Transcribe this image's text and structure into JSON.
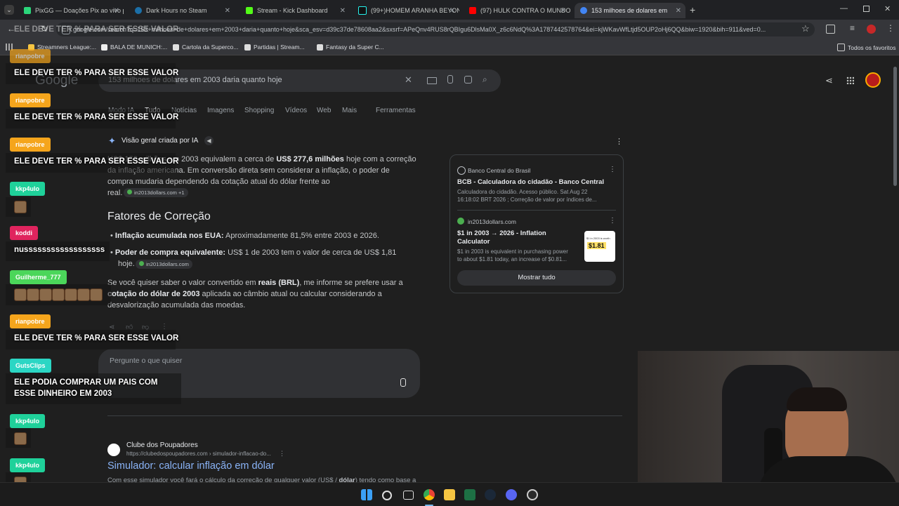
{
  "tabs": [
    {
      "label": "PixGG — Doações Pix ao vivo p",
      "color": "#2bd67b"
    },
    {
      "label": "Dark Hours no Steam",
      "color": "#1b6fa8"
    },
    {
      "label": "Stream - Kick Dashboard",
      "color": "#53fc18"
    },
    {
      "label": "(99+)HOMEM ARANHA BEYON",
      "color": "#111111"
    },
    {
      "label": "(97) HULK CONTRA O MUNDO",
      "color": "#ff0000"
    },
    {
      "label": "153 milhoes de dolares em 200",
      "color": "#4285f4"
    }
  ],
  "new_tab": "+",
  "url": "google.com/search?q=153+milhoes+de+dolares+em+2003+daria+quanto+hoje&sca_esv=d39c37de78608aa2&sxsrf=APeQnv4RUS8rQBIgu6DlsMa0X_z6c6NdQ%3A1787442578764&ei=kjWKavWfLtjd5OUP2oHj6QQ&biw=1920&bih=911&ved=0...",
  "url_overlay": "ELE DEVE TER % PARA SER ESSE VALOR",
  "bookmarks": [
    {
      "label": "Streamners League:...",
      "color": "#f5c542"
    },
    {
      "label": "BALA DE MUNICH:...",
      "color": "#eeeeee"
    },
    {
      "label": "Cartola da Superco...",
      "color": "#e0e0e0"
    },
    {
      "label": "Partidas | Stream...",
      "color": "#dddddd"
    },
    {
      "label": "Fantasy da Super C...",
      "color": "#dddddd"
    }
  ],
  "all_favorites": "Todos os favoritos",
  "google": {
    "logo": "Google",
    "query": "153 milhoes de dolares em 2003 daria quanto hoje",
    "filters": [
      "Modo IA",
      "Tudo",
      "Notícias",
      "Imagens",
      "Shopping",
      "Vídeos",
      "Web",
      "Mais",
      "Ferramentas"
    ],
    "ai_header": "Visão geral criada por IA",
    "ai_p1_a": "US$ 153 milhões em 2003 equivalem a cerca de ",
    "ai_p1_b": "US$ 277,6 milhões",
    "ai_p1_c": " hoje com a correção",
    "ai_p1_line2": "da inflação americana. Em conversão direta sem considerar a inflação, o poder de",
    "ai_p1_line3": "compra mudaria dependendo da cotação atual do dólar frente ao",
    "ai_p1_line4": "real.",
    "src_chip1": "in2013dollars.com +1",
    "heading": "Fatores de Correção",
    "bullet1_label": "Inflação acumulada nos EUA:",
    "bullet1_text": " Aproximadamente 81,5% entre 2003 e 2026.",
    "bullet2_label": "Poder de compra equivalente:",
    "bullet2_text": " US$ 1 de 2003 tem o valor de cerca de US$ 1,81",
    "bullet2_line2": "hoje.",
    "src_chip2": "in2013dollars.com",
    "p3_line1_a": "Se você quiser saber o valor convertido em ",
    "p3_line1_b": "reais (BRL)",
    "p3_line1_c": ", me informe se prefere usar a",
    "p3_line2_a": "cotação do dólar de 2003",
    "p3_line2_b": " aplicada ao câmbio atual ou calcular considerando a",
    "p3_line3": "desvalorização acumulada das moedas.",
    "card1_source": "Banco Central do Brasil",
    "card1_title": "BCB - Calculadora do cidadão - Banco Central",
    "card1_desc1": "Calculadora do cidadão. Acesso público. Sat Aug 22",
    "card1_desc2": "16:18:02 BRT 2026 ; Correção de valor por índices de...",
    "card2_source": "in2013dollars.com",
    "card2_title1": "$1 in 2003 → 2026 - Inflation",
    "card2_title2": "Calculator",
    "card2_desc1": "$1 in 2003 is equivalent in purchasing power",
    "card2_desc2": "to about $1.81 today, an increase of $0.81...",
    "card2_thumb_small": "$1 in 2003 is worth",
    "card2_thumb_big": "$1.81",
    "show_all": "Mostrar tudo",
    "ask_placeholder": "Pergunte o que quiser",
    "result_site": "Clube dos Poupadores",
    "result_url": "https://clubedospoupadores.com › simulador-inflacao-do...",
    "result_title": "Simulador: calcular inflação em dólar",
    "result_snippet_a": "Com esse simulador você fará o cálculo da correção de qualquer valor (US$ / ",
    "result_snippet_b": "dólar",
    "result_snippet_c": ") tendo como base a"
  },
  "chat": [
    {
      "user": "rianpobre",
      "color": "#f5a51c",
      "msg": "ELE DEVE TER % PARA SER ESSE VALOR"
    },
    {
      "user": "rianpobre",
      "color": "#f5a51c",
      "msg": "ELE DEVE TER % PARA SER ESSE VALOR"
    },
    {
      "user": "rianpobre",
      "color": "#f5a51c",
      "msg": "ELE DEVE TER % PARA SER ESSE VALOR"
    },
    {
      "user": "kkp4ulo",
      "color": "#1fd19a",
      "msg": ""
    },
    {
      "user": "koddi",
      "color": "#e0245e",
      "msg": "nussssssssssssssssss"
    },
    {
      "user": "Guilherme_777",
      "color": "#4bd65a",
      "msg": ""
    },
    {
      "user": "rianpobre",
      "color": "#f5a51c",
      "msg": "ELE DEVE TER % PARA SER ESSE VALOR"
    },
    {
      "user": "GutsClips",
      "color": "#2bd6c4",
      "msg1": "ELE PODIA COMPRAR UM PAIS COM",
      "msg2": "ESSE DINHEIRO EM 2003"
    },
    {
      "user": "kkp4ulo",
      "color": "#1fd19a",
      "msg": ""
    },
    {
      "user": "kkp4ulo",
      "color": "#1fd19a",
      "msg": ""
    }
  ]
}
